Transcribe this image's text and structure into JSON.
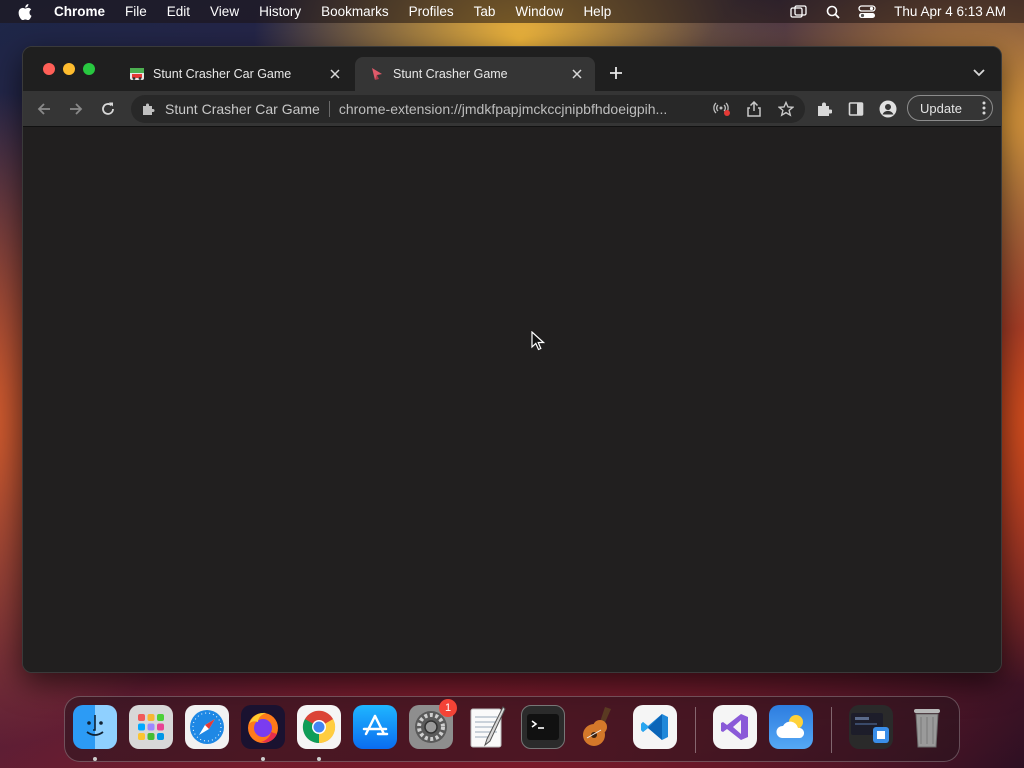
{
  "menubar": {
    "app_name": "Chrome",
    "items": [
      "File",
      "Edit",
      "View",
      "History",
      "Bookmarks",
      "Profiles",
      "Tab",
      "Window",
      "Help"
    ],
    "status_icons": [
      "screen-mirroring-icon",
      "spotlight-search-icon",
      "control-center-icon"
    ],
    "clock": "Thu Apr 4  6:13 AM"
  },
  "browser": {
    "tabs": [
      {
        "title": "Stunt Crasher Car Game",
        "icon": "game-favicon-icon",
        "active": false
      },
      {
        "title": "Stunt Crasher Game",
        "icon": "extension-favicon-icon",
        "active": true
      }
    ],
    "omnibox": {
      "site_name": "Stunt Crasher Car Game",
      "url": "chrome-extension://jmdkfpapjmckccjnipbfhdoeigpih..."
    },
    "update_label": "Update"
  },
  "dock": {
    "apps": [
      {
        "name": "Finder",
        "icon": "finder-icon",
        "running": true
      },
      {
        "name": "Launchpad",
        "icon": "launchpad-icon",
        "running": false
      },
      {
        "name": "Safari",
        "icon": "safari-icon",
        "running": false
      },
      {
        "name": "Firefox",
        "icon": "firefox-icon",
        "running": true
      },
      {
        "name": "Chrome",
        "icon": "chrome-icon",
        "running": true
      },
      {
        "name": "App Store",
        "icon": "app-store-icon",
        "running": false
      },
      {
        "name": "System Settings",
        "icon": "settings-icon",
        "running": false,
        "badge": "1"
      },
      {
        "name": "TextEdit",
        "icon": "textedit-icon",
        "running": false
      },
      {
        "name": "Terminal",
        "icon": "terminal-icon",
        "running": false
      },
      {
        "name": "GarageBand",
        "icon": "garageband-icon",
        "running": false
      },
      {
        "name": "VS Code",
        "icon": "vscode-icon",
        "running": false
      },
      {
        "name": "Visual Studio",
        "icon": "visual-studio-icon",
        "running": false
      },
      {
        "name": "Weather",
        "icon": "weather-icon",
        "running": false
      },
      {
        "name": "Downloads",
        "icon": "downloads-stack-icon",
        "running": false
      },
      {
        "name": "Trash",
        "icon": "trash-icon",
        "running": false
      }
    ]
  }
}
